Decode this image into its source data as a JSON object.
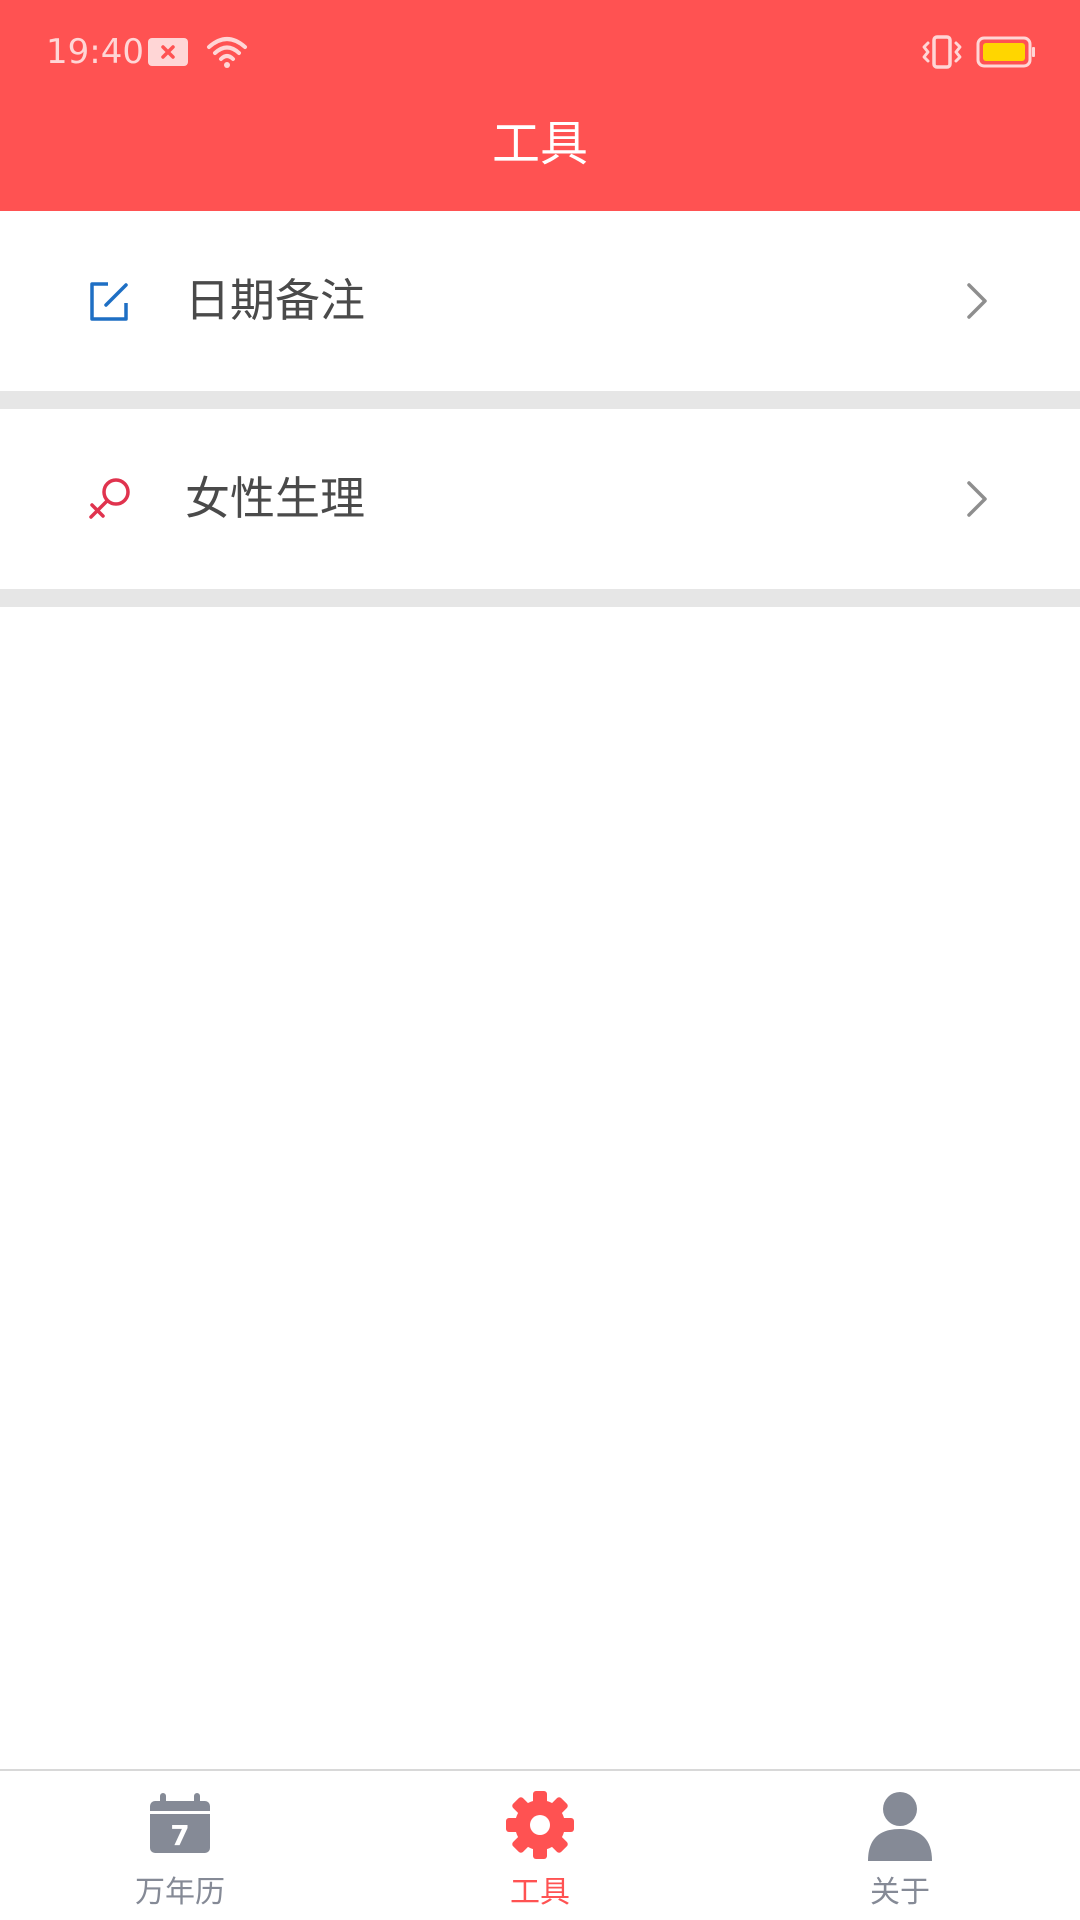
{
  "status_bar": {
    "time": "19:40",
    "icons": [
      "notification-blocked-icon",
      "wifi-icon",
      "vibrate-icon",
      "battery-icon"
    ]
  },
  "header": {
    "title": "工具",
    "background_color": "#FF5252"
  },
  "menu": {
    "items": [
      {
        "label": "日期备注",
        "icon": "edit-note-icon",
        "icon_color": "#1E6FC4"
      },
      {
        "label": "女性生理",
        "icon": "female-symbol-icon",
        "icon_color": "#E0334E"
      }
    ]
  },
  "bottom_nav": {
    "tabs": [
      {
        "label": "万年历",
        "icon": "calendar-icon",
        "icon_text": "7",
        "active": false
      },
      {
        "label": "工具",
        "icon": "gear-icon",
        "active": true
      },
      {
        "label": "关于",
        "icon": "user-icon",
        "active": false
      }
    ],
    "active_color": "#FF5252",
    "inactive_color": "#858A96"
  }
}
